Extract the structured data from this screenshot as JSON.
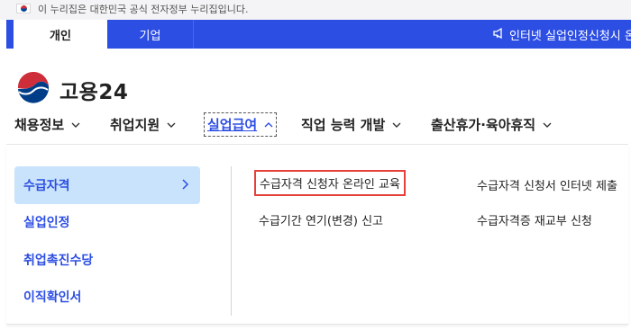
{
  "gov_banner": {
    "text": "이 누리집은 대한민국 공식 전자정부 누리집입니다."
  },
  "tabs": [
    {
      "label": "개인"
    },
    {
      "label": "기업"
    }
  ],
  "notice": {
    "icon": "megaphone-icon",
    "text": "인터넷 실업인정신청시 온라"
  },
  "logo": {
    "text": "고용24"
  },
  "gnb": [
    {
      "label": "채용정보"
    },
    {
      "label": "취업지원"
    },
    {
      "label": "실업급여",
      "active": true
    },
    {
      "label": "직업 능력 개발"
    },
    {
      "label": "출산휴가·육아휴직"
    }
  ],
  "sidebar": {
    "items": [
      {
        "label": "수급자격",
        "selected": true
      },
      {
        "label": "실업인정"
      },
      {
        "label": "취업촉진수당"
      },
      {
        "label": "이직확인서"
      }
    ]
  },
  "submenu": {
    "links": [
      {
        "label": "수급자격 신청자 온라인 교육",
        "highlighted": true
      },
      {
        "label": "수급자격 신청서 인터넷 제출"
      },
      {
        "label": "수급기간 연기(변경) 신고"
      },
      {
        "label": "수급자격증 재교부 신청"
      }
    ]
  },
  "colors": {
    "accent": "#2d4ee3",
    "selected_bg": "#c8e3fb",
    "highlight_border": "#e5413a"
  }
}
